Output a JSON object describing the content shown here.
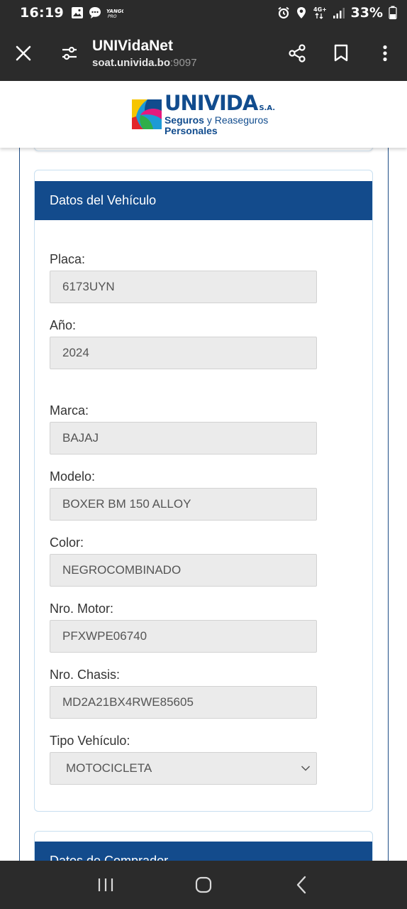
{
  "status_bar": {
    "time": "16:19",
    "battery": "33%",
    "network": "4G+"
  },
  "browser": {
    "title": "UNIVidaNet",
    "url_host": "soat.univida.bo",
    "url_port": ":9097"
  },
  "logo": {
    "brand": "UNIVIDA",
    "suffix": "S.A.",
    "line1_bold": "Seguros",
    "line1_rest": " y Reaseguros",
    "line2": "Personales"
  },
  "vehicle_section": {
    "title": "Datos del Vehículo",
    "fields": [
      {
        "label": "Placa:",
        "value": "6173UYN"
      },
      {
        "label": "Año:",
        "value": "2024"
      },
      {
        "label": "Marca:",
        "value": "BAJAJ"
      },
      {
        "label": "Modelo:",
        "value": "BOXER BM 150 ALLOY"
      },
      {
        "label": "Color:",
        "value": "NEGROCOMBINADO"
      },
      {
        "label": "Nro. Motor:",
        "value": "PFXWPE06740"
      },
      {
        "label": "Nro. Chasis:",
        "value": "MD2A21BX4RWE85605"
      },
      {
        "label": "Tipo Vehículo:",
        "value": "MOTOCICLETA"
      }
    ]
  },
  "buyer_section": {
    "title": "Datos de Comprador"
  },
  "colors": {
    "header_blue": "#134b8c",
    "chrome_bg": "#2b2b2b",
    "field_bg": "#ebebeb"
  }
}
